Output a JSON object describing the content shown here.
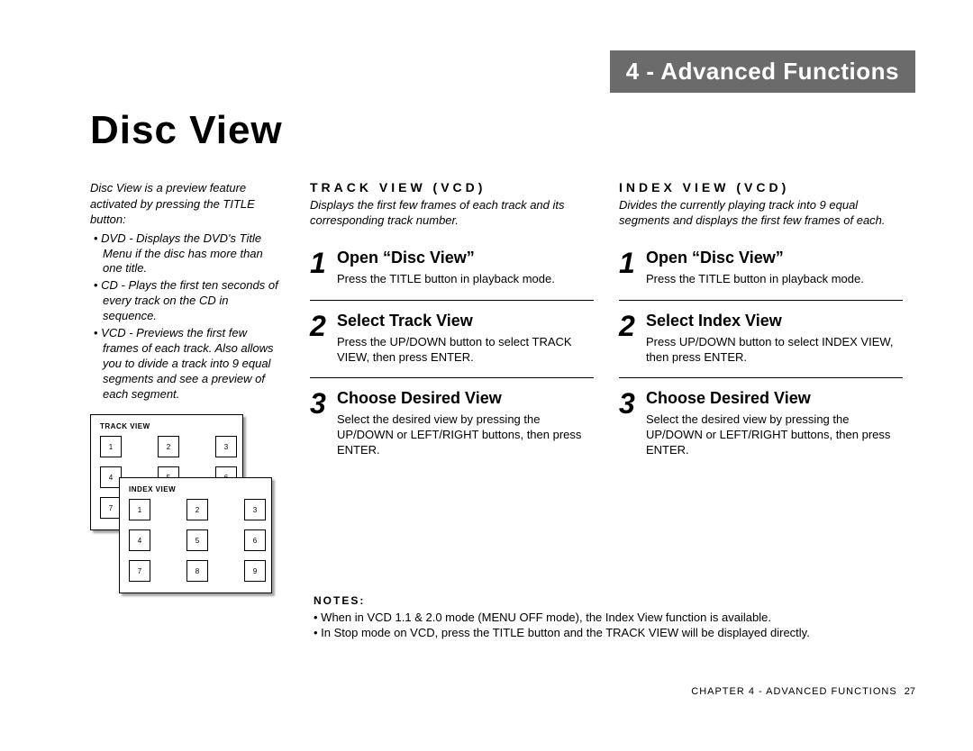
{
  "chapter_banner": "4 - Advanced Functions",
  "page_title": "Disc View",
  "left": {
    "intro": "Disc View is a preview feature activated by pressing the TITLE button:",
    "bullets": [
      "DVD - Displays the DVD's Title Menu if the disc has more than one title.",
      "CD - Plays the first ten seconds of every track on the CD in sequence.",
      "VCD - Previews the first few frames of each track. Also allows you to divide a track into 9 equal segments and see a preview of each segment."
    ],
    "diagram": {
      "top_label": "TRACK VIEW",
      "bottom_label": "INDEX VIEW",
      "cells": [
        "1",
        "2",
        "3",
        "4",
        "5",
        "6",
        "7",
        "8",
        "9"
      ]
    }
  },
  "track_view": {
    "header": "TRACK VIEW (VCD)",
    "desc": "Displays the first few frames of each track and its corresponding track number.",
    "steps": [
      {
        "num": "1",
        "title": "Open “Disc View”",
        "text": "Press the TITLE button in playback mode."
      },
      {
        "num": "2",
        "title": "Select Track View",
        "text": "Press the UP/DOWN button to select TRACK VIEW, then press ENTER."
      },
      {
        "num": "3",
        "title": "Choose Desired View",
        "text": "Select the desired view by pressing the UP/DOWN or LEFT/RIGHT buttons, then press ENTER."
      }
    ]
  },
  "index_view": {
    "header": "INDEX VIEW (VCD)",
    "desc": "Divides the currently playing track into 9 equal segments and displays the first few frames of each.",
    "steps": [
      {
        "num": "1",
        "title": "Open “Disc View”",
        "text": "Press the TITLE button in playback mode."
      },
      {
        "num": "2",
        "title": "Select Index View",
        "text": "Press UP/DOWN button to select INDEX VIEW, then press ENTER."
      },
      {
        "num": "3",
        "title": "Choose Desired View",
        "text": "Select the desired view by pressing the UP/DOWN or LEFT/RIGHT buttons, then press ENTER."
      }
    ]
  },
  "notes": {
    "header": "NOTES:",
    "items": [
      "When in VCD 1.1 & 2.0 mode (MENU OFF mode), the Index View function is available.",
      "In Stop mode on VCD, press the TITLE button and the TRACK VIEW will be displayed directly."
    ]
  },
  "footer": {
    "text": "CHAPTER 4 - ADVANCED FUNCTIONS",
    "page": "27"
  }
}
